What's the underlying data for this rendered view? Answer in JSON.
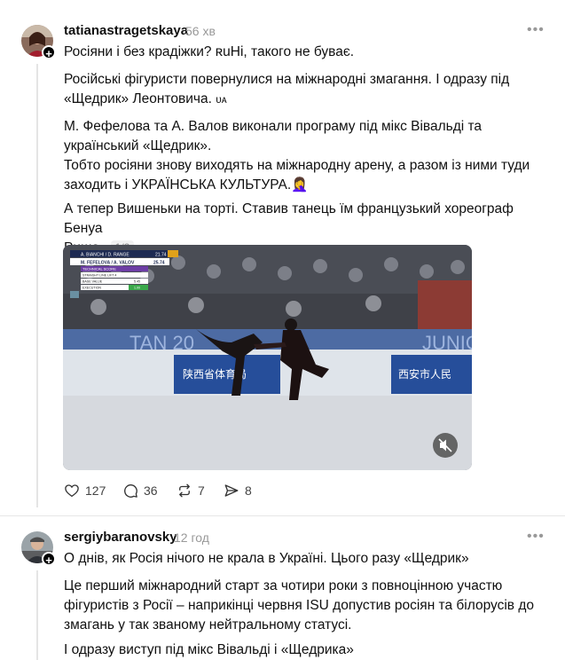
{
  "post1": {
    "username": "tatianastragetskaya",
    "time": "56 хв",
    "line1": "Росіяни і без крадіжки? ʀuНі, такого не буває.",
    "para2_line1": "Російські фігуристи повернулися на міжнародні змагання. І одразу під",
    "para2_line2": "«Щедрик» Леонтовича.",
    "para2_flag": "ᴜᴀ",
    "para3_line1": "М. Фефелова та А. Валов виконали програму під мікс Вівальді та",
    "para3_line2": "український «Щедрик».",
    "para3_line3": "Тобто росіяни знову виходять на міжнародну арену, а разом із ними туди",
    "para3_line4": "заходить і УКРАЇНСЬКА КУЛЬТУРА.",
    "para3_emoji": "🤦‍♀️",
    "para4_line1": "А тепер Вишеньки на торті. Ставив танець їм французький хореограф Бенуа",
    "para4_line2": "Ришо.",
    "page_badge": "1/2",
    "video": {
      "score_top": "A. BIANCHI / D. RANGE",
      "score_top_val": "21.74",
      "score_name": "M. FEFELOVA / A. VALOV",
      "score_val": "25.74",
      "tech_label": "TECHNICAL SCORE",
      "elem1": "STRAIGHT LINE LIFT 4",
      "elem2": "BASE VALUE",
      "elem2_val": "5.45",
      "elem3": "EXECUTION",
      "elem3_val": "1.00",
      "board1": "陕西省体育局",
      "board2": "西安市人民",
      "banner_left": "TAN 20",
      "banner_right": "JUNIO"
    },
    "likes": "127",
    "comments": "36",
    "reposts": "7",
    "shares": "8"
  },
  "post2": {
    "username": "sergiybaranovsky",
    "time": "12 год",
    "line1": "О днів, як Росія нічого не крала в Україні. Цього разу «Щедрик»",
    "para2_line1": "Це перший міжнародний старт за чотири роки з повноцінною участю",
    "para2_line2": "фігуристів з Росії – наприкінці червня ISU допустив росіян та білорусів до",
    "para2_line3": "змагань у так званому нейтральному статусі.",
    "para3_line1": "І одразу виступ під мікс Вівальді і «Щедрика»"
  },
  "colors": {
    "text": "#101010",
    "muted": "#999999",
    "divider": "#e7e7e7"
  }
}
